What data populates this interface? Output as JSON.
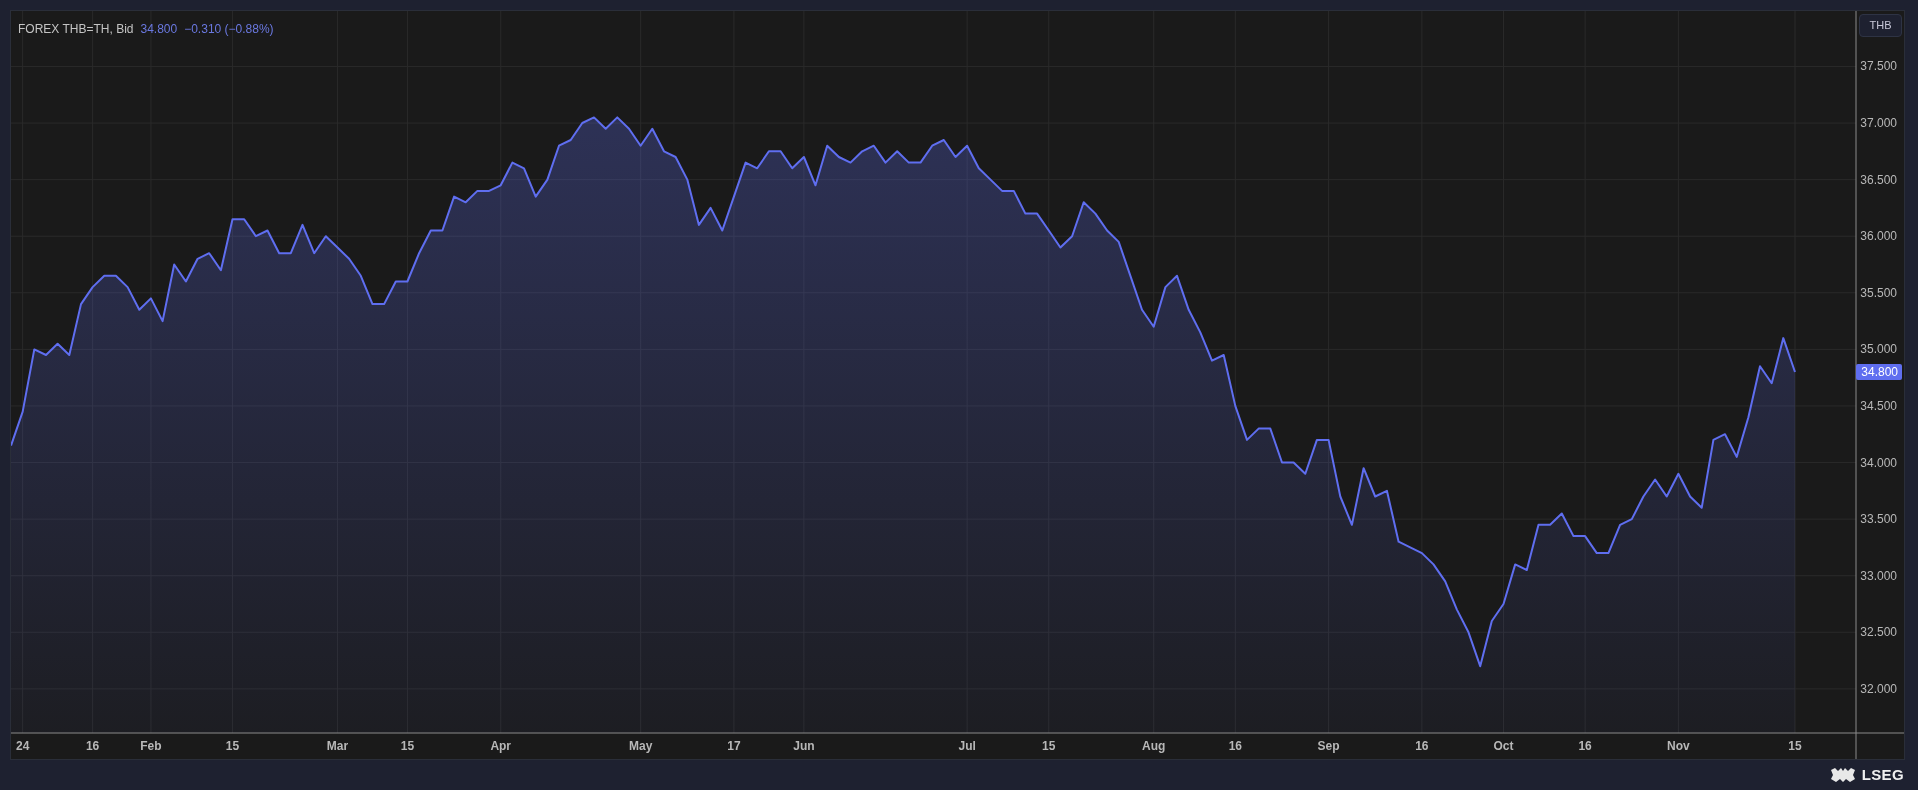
{
  "currency_button": "THB",
  "legend": {
    "price": "34.800",
    "change": "−0.310 (−0.88%)"
  },
  "chart": {
    "chart_data": {
      "type": "area",
      "series": [
        {
          "name": "FOREX THB=TH, Bid",
          "color": "#5f6ef0",
          "values": [
            34.15,
            34.45,
            35.0,
            34.95,
            35.05,
            34.95,
            35.4,
            35.55,
            35.65,
            35.65,
            35.55,
            35.35,
            35.45,
            35.25,
            35.75,
            35.6,
            35.8,
            35.85,
            35.7,
            36.15,
            36.15,
            36.0,
            36.05,
            35.85,
            35.85,
            36.1,
            35.85,
            36.0,
            35.9,
            35.8,
            35.65,
            35.4,
            35.4,
            35.6,
            35.6,
            35.85,
            36.05,
            36.05,
            36.35,
            36.3,
            36.4,
            36.4,
            36.45,
            36.65,
            36.6,
            36.35,
            36.5,
            36.8,
            36.85,
            37.0,
            37.05,
            36.95,
            37.05,
            36.95,
            36.8,
            36.95,
            36.75,
            36.7,
            36.5,
            36.1,
            36.25,
            36.05,
            36.35,
            36.65,
            36.6,
            36.75,
            36.75,
            36.6,
            36.7,
            36.45,
            36.8,
            36.7,
            36.65,
            36.75,
            36.8,
            36.65,
            36.75,
            36.65,
            36.65,
            36.8,
            36.85,
            36.7,
            36.8,
            36.6,
            36.5,
            36.4,
            36.4,
            36.2,
            36.2,
            36.05,
            35.9,
            36.0,
            36.3,
            36.2,
            36.05,
            35.95,
            35.65,
            35.35,
            35.2,
            35.55,
            35.65,
            35.35,
            35.15,
            34.9,
            34.95,
            34.5,
            34.2,
            34.3,
            34.3,
            34.0,
            34.0,
            33.9,
            34.2,
            34.2,
            33.7,
            33.45,
            33.95,
            33.7,
            33.75,
            33.3,
            33.25,
            33.2,
            33.1,
            32.95,
            32.7,
            32.5,
            32.2,
            32.6,
            32.75,
            33.1,
            33.05,
            33.45,
            33.45,
            33.55,
            33.35,
            33.35,
            33.2,
            33.2,
            33.45,
            33.5,
            33.7,
            33.85,
            33.7,
            33.9,
            33.7,
            33.6,
            34.2,
            34.25,
            34.05,
            34.4,
            34.85,
            34.7,
            35.1,
            34.8
          ]
        }
      ],
      "categories": [
        null,
        "24",
        null,
        null,
        null,
        null,
        null,
        "16",
        null,
        null,
        null,
        null,
        "Feb",
        null,
        null,
        null,
        null,
        null,
        null,
        "15",
        null,
        null,
        null,
        null,
        null,
        null,
        null,
        null,
        "Mar",
        null,
        null,
        null,
        null,
        null,
        "15",
        null,
        null,
        null,
        null,
        null,
        null,
        null,
        "Apr",
        null,
        null,
        null,
        null,
        null,
        null,
        null,
        null,
        null,
        null,
        null,
        "May",
        null,
        null,
        null,
        null,
        null,
        null,
        null,
        "17",
        null,
        null,
        null,
        null,
        null,
        "Jun",
        null,
        null,
        null,
        null,
        null,
        null,
        null,
        null,
        null,
        null,
        null,
        null,
        null,
        "Jul",
        null,
        null,
        null,
        null,
        null,
        null,
        "15",
        null,
        null,
        null,
        null,
        null,
        null,
        null,
        null,
        "Aug",
        null,
        null,
        null,
        null,
        null,
        null,
        "16",
        null,
        null,
        null,
        null,
        null,
        null,
        null,
        "Sep",
        null,
        null,
        null,
        null,
        null,
        null,
        null,
        "16",
        null,
        null,
        null,
        null,
        null,
        null,
        "Oct",
        null,
        null,
        null,
        null,
        null,
        null,
        "16",
        null,
        null,
        null,
        null,
        null,
        null,
        null,
        "Nov",
        null,
        null,
        null,
        null,
        null,
        null,
        null,
        null,
        null,
        "15"
      ],
      "grid": true,
      "ylim": [
        31.61,
        37.99
      ],
      "yticks": [
        {
          "value": 32,
          "label": "32.000"
        },
        {
          "value": 32.5,
          "label": "32.500"
        },
        {
          "value": 33,
          "label": "33.000"
        },
        {
          "value": 33.5,
          "label": "33.500"
        },
        {
          "value": 34,
          "label": "34.000"
        },
        {
          "value": 34.5,
          "label": "34.500"
        },
        {
          "value": 35,
          "label": "35.000"
        },
        {
          "value": 35.5,
          "label": "35.500"
        },
        {
          "value": 36,
          "label": "36.000"
        },
        {
          "value": 36.5,
          "label": "36.500"
        },
        {
          "value": 37,
          "label": "37.000"
        },
        {
          "value": 37.5,
          "label": "37.500"
        }
      ]
    },
    "last_price_label": "34.800"
  },
  "footer": {
    "brand": "LSEG"
  }
}
